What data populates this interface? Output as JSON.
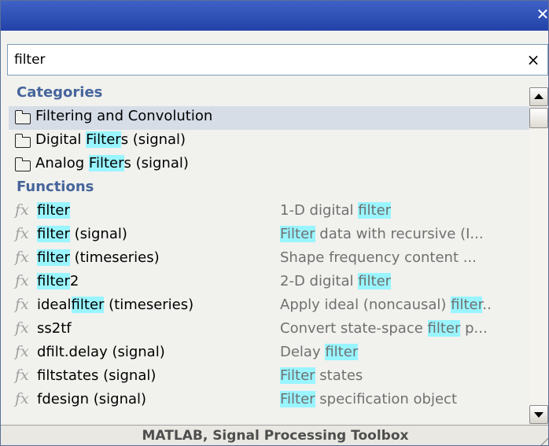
{
  "window": {
    "close_label": "✕"
  },
  "search": {
    "value": "filter",
    "clear_label": "×"
  },
  "categories_header": "Categories",
  "categories": [
    {
      "label": [
        {
          "t": "Filtering and Convolution",
          "h": false
        }
      ],
      "selected": true
    },
    {
      "label": [
        {
          "t": "Digital ",
          "h": false
        },
        {
          "t": "Filter",
          "h": true
        },
        {
          "t": "s (signal)",
          "h": false
        }
      ],
      "selected": false
    },
    {
      "label": [
        {
          "t": "Analog ",
          "h": false
        },
        {
          "t": "Filter",
          "h": true
        },
        {
          "t": "s (signal)",
          "h": false
        }
      ],
      "selected": false
    }
  ],
  "functions_header": "Functions",
  "functions": [
    {
      "name": [
        {
          "t": "filter",
          "h": true
        }
      ],
      "desc": [
        {
          "t": "1-D digital ",
          "h": false
        },
        {
          "t": "filter",
          "h": true
        }
      ]
    },
    {
      "name": [
        {
          "t": "filter",
          "h": true
        },
        {
          "t": " (signal)",
          "h": false
        }
      ],
      "desc": [
        {
          "t": "Filter",
          "h": true
        },
        {
          "t": " data with recursive (I...",
          "h": false
        }
      ]
    },
    {
      "name": [
        {
          "t": "filter",
          "h": true
        },
        {
          "t": " (timeseries)",
          "h": false
        }
      ],
      "desc": [
        {
          "t": "Shape frequency content ...",
          "h": false
        }
      ]
    },
    {
      "name": [
        {
          "t": "filter",
          "h": true
        },
        {
          "t": "2",
          "h": false
        }
      ],
      "desc": [
        {
          "t": "2-D digital ",
          "h": false
        },
        {
          "t": "filter",
          "h": true
        }
      ]
    },
    {
      "name": [
        {
          "t": "ideal",
          "h": false
        },
        {
          "t": "filter",
          "h": true
        },
        {
          "t": " (timeseries)",
          "h": false
        }
      ],
      "desc": [
        {
          "t": "Apply ideal (noncausal) ",
          "h": false
        },
        {
          "t": "filter",
          "h": true
        },
        {
          "t": "..",
          "h": false
        }
      ]
    },
    {
      "name": [
        {
          "t": "ss2tf",
          "h": false
        }
      ],
      "desc": [
        {
          "t": "Convert state-space ",
          "h": false
        },
        {
          "t": "filter",
          "h": true
        },
        {
          "t": " p...",
          "h": false
        }
      ]
    },
    {
      "name": [
        {
          "t": "dfilt.delay (signal)",
          "h": false
        }
      ],
      "desc": [
        {
          "t": "Delay ",
          "h": false
        },
        {
          "t": "filter",
          "h": true
        }
      ]
    },
    {
      "name": [
        {
          "t": "filtstates (signal)",
          "h": false
        }
      ],
      "desc": [
        {
          "t": "Filter",
          "h": true
        },
        {
          "t": " states",
          "h": false
        }
      ]
    },
    {
      "name": [
        {
          "t": "fdesign (signal)",
          "h": false
        }
      ],
      "desc": [
        {
          "t": "Filter",
          "h": true
        },
        {
          "t": " specification object",
          "h": false
        }
      ]
    }
  ],
  "status": "MATLAB, Signal Processing Toolbox",
  "colors": {
    "titlebar": "#2a4bb2",
    "highlight": "#99f5ff",
    "section_header": "#46659b",
    "selected_row": "#d6dde7",
    "description": "#707070"
  }
}
